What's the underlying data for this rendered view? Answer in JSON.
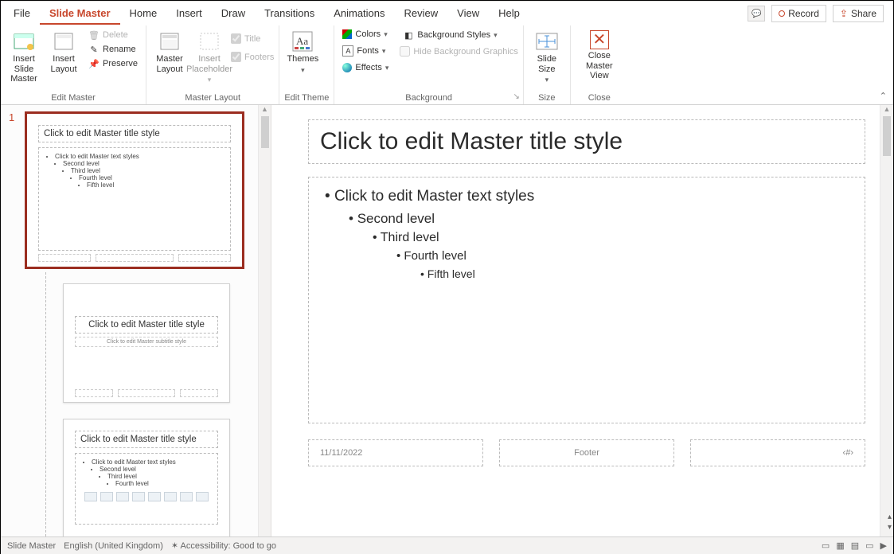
{
  "tabs": {
    "file": "File",
    "slide_master": "Slide Master",
    "home": "Home",
    "insert": "Insert",
    "draw": "Draw",
    "transitions": "Transitions",
    "animations": "Animations",
    "review": "Review",
    "view": "View",
    "help": "Help"
  },
  "top_right": {
    "record": "Record",
    "share": "Share"
  },
  "ribbon": {
    "edit_master": {
      "insert_slide_master": "Insert Slide\nMaster",
      "insert_layout": "Insert\nLayout",
      "delete": "Delete",
      "rename": "Rename",
      "preserve": "Preserve",
      "group_label": "Edit Master"
    },
    "master_layout": {
      "master_layout": "Master\nLayout",
      "insert_placeholder": "Insert\nPlaceholder",
      "title": "Title",
      "footers": "Footers",
      "group_label": "Master Layout"
    },
    "edit_theme": {
      "themes": "Themes",
      "group_label": "Edit Theme"
    },
    "background": {
      "colors": "Colors",
      "fonts": "Fonts",
      "effects": "Effects",
      "bg_styles": "Background Styles",
      "hide_bg": "Hide Background Graphics",
      "group_label": "Background"
    },
    "size": {
      "slide_size": "Slide\nSize",
      "group_label": "Size"
    },
    "close": {
      "close_master": "Close\nMaster View",
      "group_label": "Close"
    }
  },
  "thumbnails": {
    "master_index": "1",
    "master": {
      "title": "Click to edit Master title style",
      "l1": "Click to edit Master text styles",
      "l2": "Second level",
      "l3": "Third level",
      "l4": "Fourth level",
      "l5": "Fifth level"
    },
    "layout1": {
      "title": "Click to edit Master title style",
      "subtitle": "Click to edit Master subtitle style"
    },
    "layout2": {
      "title": "Click to edit Master title style",
      "l1": "Click to edit Master text styles",
      "l2": "Second level",
      "l3": "Third level",
      "l4": "Fourth level"
    }
  },
  "slide": {
    "title": "Click to edit Master title style",
    "l1": "Click to edit Master text styles",
    "l2": "Second level",
    "l3": "Third level",
    "l4": "Fourth level",
    "l5": "Fifth level",
    "date": "11/11/2022",
    "footer": "Footer",
    "slidenum": "‹#›"
  },
  "statusbar": {
    "view": "Slide Master",
    "lang": "English (United Kingdom)",
    "access": "Accessibility: Good to go"
  }
}
